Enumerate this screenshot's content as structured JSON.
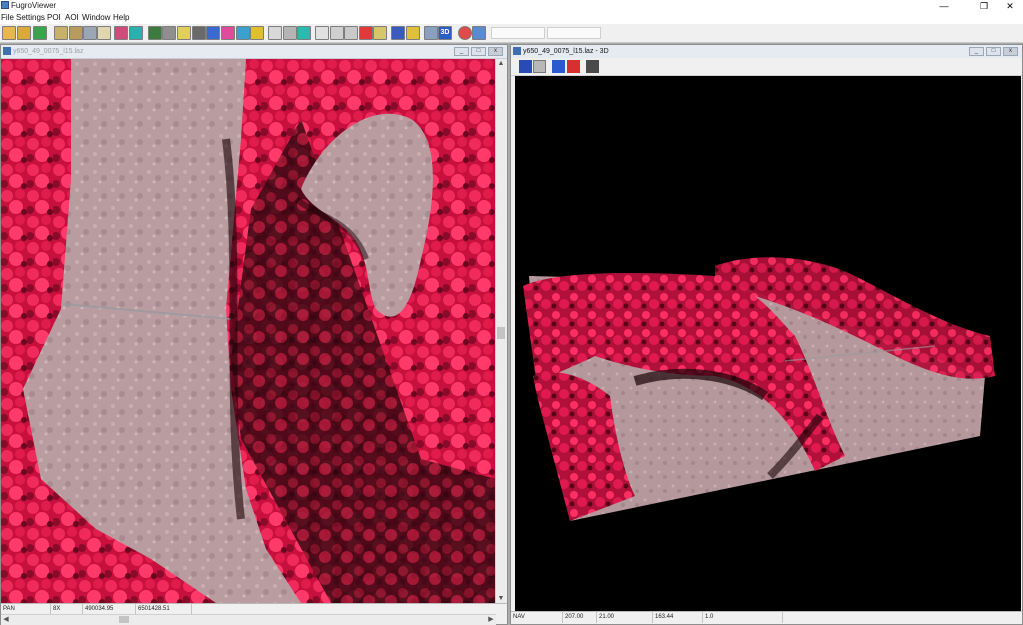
{
  "app": {
    "title": "FugroViewer"
  },
  "window_controls": {
    "minimize": "—",
    "restore": "❐",
    "close": "✕"
  },
  "menu": [
    "File",
    "Settings",
    "POI",
    "AOI",
    "Window",
    "Help"
  ],
  "toolbar": {
    "icons": [
      "open-file",
      "open-folder",
      "reload",
      "layers",
      "layers-2",
      "grid",
      "color-ramp",
      "select-region",
      "elevation-legend",
      "intensity",
      "profile-line",
      "color-by-class",
      "rgb-color",
      "palette",
      "stats",
      "measure",
      "grid-points",
      "tin",
      "pan-hand",
      "zoom-box",
      "print",
      "poi-pin",
      "location",
      "help",
      "ruler",
      "pencil",
      "3d-view",
      "stop",
      "refresh"
    ],
    "view_3d_label": "3D"
  },
  "left_window": {
    "title": "y650_49_0075_l15.laz",
    "status": {
      "mode": "PAN",
      "zoom": "8X",
      "x": "490034.95",
      "y": "6501428.51"
    }
  },
  "right_window": {
    "title": "y650_49_0075_l15.laz - 3D",
    "nav_icons": [
      "home-view",
      "open-view",
      "move-down",
      "reset-home"
    ],
    "status": {
      "mode": "NAV",
      "v1": "207.00",
      "v2": "21.00",
      "v3": "163.44",
      "v4": "1.0"
    }
  },
  "colors": {
    "vegetation": "#d8184a",
    "field": "#b49a9e",
    "shadow": "#1a0408"
  }
}
